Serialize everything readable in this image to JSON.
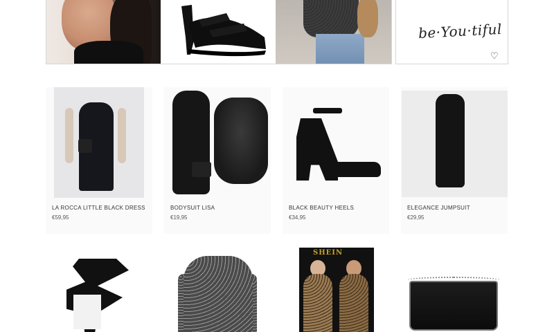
{
  "hero": {
    "quote_text": "be·You·tiful",
    "quote_heart": "♡"
  },
  "products": [
    {
      "name": "LA ROCCA LITTLE BLACK DRESS",
      "price": "€59,95"
    },
    {
      "name": "BODYSUIT LISA",
      "price": "€19,95"
    },
    {
      "name": "BLACK BEAUTY HEELS",
      "price": "€34,95"
    },
    {
      "name": "ELEGANCE JUMPSUIT",
      "price": "€29,95"
    }
  ],
  "row2_images": [
    "lace-up-heel-image",
    "mesh-bodysuit-image",
    "leopard-dress-image",
    "chain-clutch-image"
  ],
  "leopard_banner": "SHEIN"
}
